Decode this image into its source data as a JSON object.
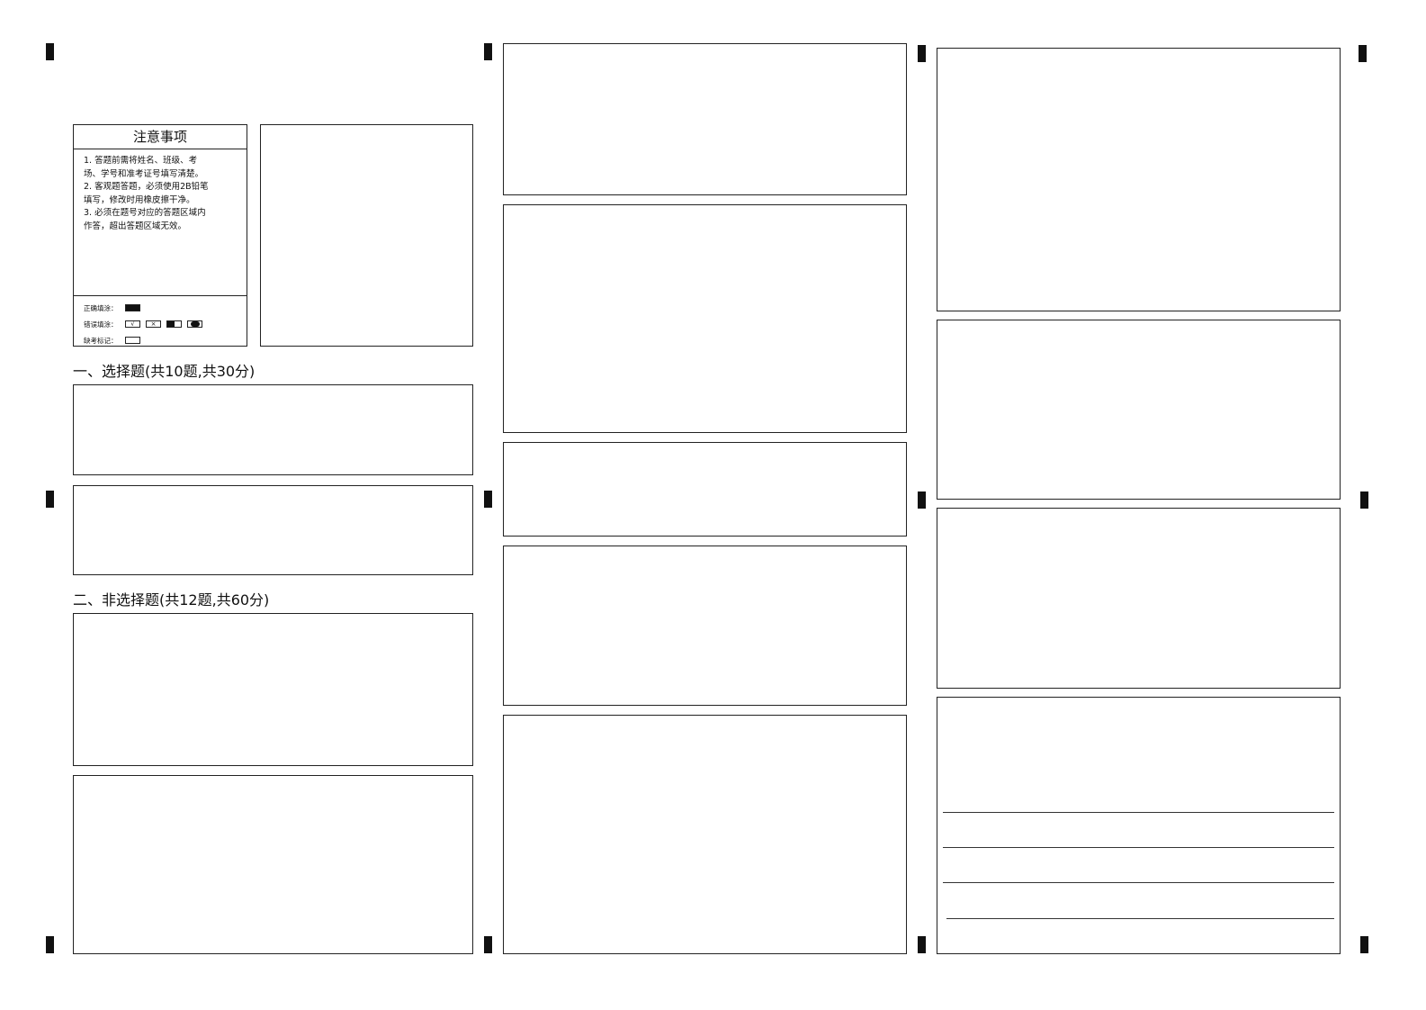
{
  "notice": {
    "title": "注意事项",
    "items": [
      "1. 答题前需将姓名、班级、考",
      "场、学号和准考证号填写清楚。",
      "2. 客观题答题，必须使用2B铅笔",
      "填写，修改时用橡皮擦干净。",
      "3. 必须在题号对应的答题区域内",
      "作答，超出答题区域无效。"
    ],
    "fill_correct_label": "正确填涂：",
    "fill_wrong_label": "错误填涂：",
    "absent_label": "缺考标记：",
    "wrong_marks": [
      "√",
      "×",
      "",
      ""
    ]
  },
  "sections": {
    "choice_title": "一、选择题(共10题,共30分)",
    "nonchoice_title": "二、非选择题(共12题,共60分)"
  }
}
